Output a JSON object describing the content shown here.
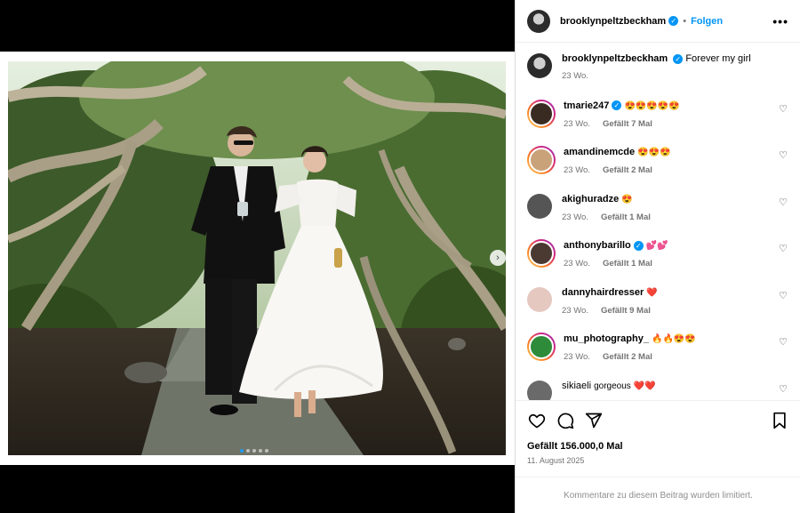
{
  "header": {
    "username": "brooklynpeltzbeckham",
    "follow_label": "Folgen",
    "more_icon": "more-icon"
  },
  "caption": {
    "username": "brooklynpeltzbeckham",
    "text": "Forever my girl",
    "age": "23 Wo."
  },
  "comments": [
    {
      "username": "tmarie247",
      "verified": true,
      "text": "😍😍😍😍😍",
      "age": "23 Wo.",
      "likes": "Gefällt 7 Mal"
    },
    {
      "username": "amandinemcde",
      "verified": false,
      "text": "😍😍😍",
      "age": "23 Wo.",
      "likes": "Gefällt 2 Mal"
    },
    {
      "username": "akighuradze",
      "verified": false,
      "text": "😍",
      "age": "23 Wo.",
      "likes": "Gefällt 1 Mal"
    },
    {
      "username": "anthonybarillo",
      "verified": true,
      "text": "💕💕",
      "age": "23 Wo.",
      "likes": "Gefällt 1 Mal"
    },
    {
      "username": "dannyhairdresser",
      "verified": false,
      "text": "❤️",
      "age": "23 Wo.",
      "likes": "Gefällt 9 Mal"
    },
    {
      "username": "mu_photography_",
      "verified": false,
      "text": "🔥🔥😍😍",
      "age": "23 Wo.",
      "likes": "Gefällt 2 Mal"
    },
    {
      "username": "sikiaeli",
      "verified": false,
      "text": "gorgeous ❤️❤️",
      "age": "",
      "likes": ""
    }
  ],
  "post": {
    "likes_text": "Gefällt 156.000,0 Mal",
    "date": "11. August 2025",
    "comments_limited": "Kommentare zu diesem Beitrag wurden limitiert."
  },
  "carousel": {
    "count": 5,
    "active": 1
  },
  "colors": {
    "accent": "#0095f6",
    "muted": "#737373"
  }
}
